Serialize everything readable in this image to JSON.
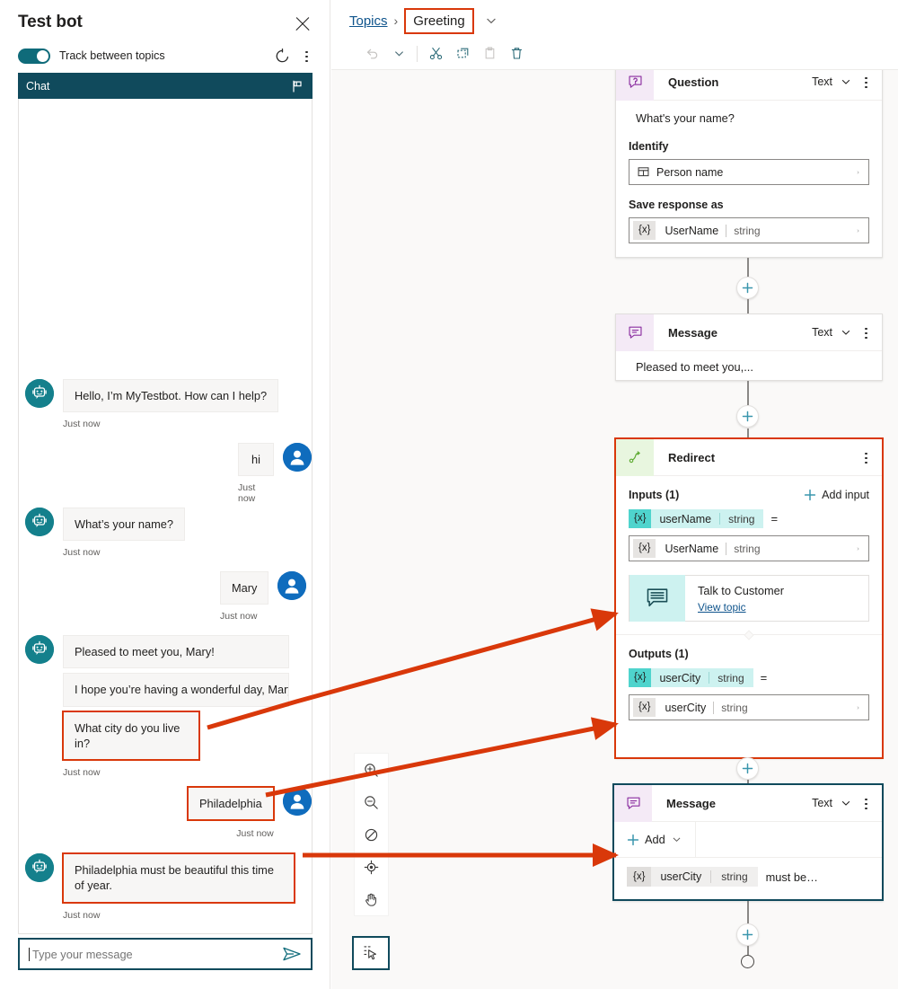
{
  "test_bot": {
    "title": "Test bot",
    "close_icon": "close-icon",
    "toggle_label": "Track between topics",
    "refresh_icon": "refresh-icon",
    "more_icon": "more-vertical-icon",
    "chat_tab_label": "Chat",
    "flag_icon": "flag-icon",
    "input": {
      "value": "",
      "placeholder": "Type your message"
    },
    "send_icon": "send-icon",
    "messages": [
      {
        "from": "bot",
        "text": "Hello, I’m MyTestbot. How can I help?",
        "stamp": "Just now",
        "highlight": false
      },
      {
        "from": "user",
        "text": "hi",
        "stamp": "Just now",
        "highlight": false
      },
      {
        "from": "bot",
        "text": "What’s your name?",
        "stamp": "Just now",
        "highlight": false
      },
      {
        "from": "user",
        "text": "Mary",
        "stamp": "Just now",
        "highlight": false
      },
      {
        "from": "bot",
        "text": "Pleased to meet you, Mary!",
        "stamp": "",
        "highlight": false
      },
      {
        "from": "bot",
        "text": "I hope you’re having a wonderful day, Mary!",
        "stamp": "",
        "highlight": false
      },
      {
        "from": "bot",
        "text": "What city do you live in?",
        "stamp": "Just now",
        "highlight": true
      },
      {
        "from": "user",
        "text": "Philadelphia",
        "stamp": "Just now",
        "highlight": true
      },
      {
        "from": "bot",
        "text": "Philadelphia must be beautiful this time of year.",
        "stamp": "Just now",
        "highlight": true
      }
    ]
  },
  "authoring": {
    "breadcrumb": {
      "parent": "Topics",
      "separator": "›",
      "current": "Greeting"
    },
    "toolbar": {
      "undo_icon": "undo-icon",
      "undo_dropdown_icon": "chevron-down-icon",
      "cut_icon": "cut-icon",
      "copy_icon": "copy-icon",
      "paste_icon": "paste-icon",
      "delete_icon": "trash-icon"
    },
    "nodes": {
      "question": {
        "title": "Question",
        "type": "Text",
        "icon": "question-node-icon",
        "more_icon": "more-vertical-icon",
        "prompt": "What's your name?",
        "identify_label": "Identify",
        "identify_value": "Person name",
        "identify_icon": "entity-icon",
        "save_label": "Save response as",
        "variable": {
          "x": "{x}",
          "name": "UserName",
          "type": "string"
        }
      },
      "message_top": {
        "title": "Message",
        "type": "Text",
        "icon": "message-node-icon",
        "more_icon": "more-vertical-icon",
        "text": "Pleased to meet you,..."
      },
      "redirect": {
        "title": "Redirect",
        "icon": "redirect-node-icon",
        "more_icon": "more-vertical-icon",
        "inputs_label": "Inputs (1)",
        "add_input_label": "Add input",
        "add_input_icon": "plus-icon",
        "input_pill": {
          "x": "{x}",
          "name": "userName",
          "type": "string"
        },
        "input_equals": "=",
        "input_value": {
          "x": "{x}",
          "name": "UserName",
          "type": "string"
        },
        "topic_card": {
          "name": "Talk to Customer",
          "link": "View topic",
          "icon": "topic-icon"
        },
        "outputs_label": "Outputs (1)",
        "output_pill": {
          "x": "{x}",
          "name": "userCity",
          "type": "string"
        },
        "output_equals": "=",
        "output_value": {
          "x": "{x}",
          "name": "userCity",
          "type": "string"
        }
      },
      "message_bottom": {
        "title": "Message",
        "type": "Text",
        "icon": "message-node-icon",
        "more_icon": "more-vertical-icon",
        "add_label": "Add",
        "add_icon": "plus-icon",
        "add_chevron_icon": "chevron-down-icon",
        "variable": {
          "x": "{x}",
          "name": "userCity",
          "type": "string"
        },
        "trailing_text": "must be…"
      }
    },
    "zoom_toolbar": [
      {
        "icon": "zoom-in-icon",
        "name": "zoom-in"
      },
      {
        "icon": "zoom-out-icon",
        "name": "zoom-out"
      },
      {
        "icon": "reset-zoom-icon",
        "name": "reset-zoom"
      },
      {
        "icon": "fit-to-screen-icon",
        "name": "fit-to-screen"
      },
      {
        "icon": "pan-hand-icon",
        "name": "pan"
      }
    ],
    "select_tool": {
      "icon": "select-cursor-icon",
      "active": true
    },
    "add_node_icon": "plus-icon",
    "end_node_icon": "end-circle-icon"
  },
  "annotations": {
    "color": "#d9380a",
    "arrows": [
      {
        "from": "chat-message-what-city",
        "to": "redirect-topic-card"
      },
      {
        "from": "chat-message-philadelphia",
        "to": "redirect-output-value"
      },
      {
        "from": "chat-message-philadelphia-must",
        "to": "message-bottom-add"
      }
    ]
  },
  "colors": {
    "accent_teal": "#104a5c",
    "annotation_red": "#d9380a",
    "user_avatar_blue": "#0f6cbd",
    "bot_avatar_teal": "#14808c",
    "variable_pill_cyan": "#cdf2f0",
    "canvas_bg": "#faf9f8"
  }
}
